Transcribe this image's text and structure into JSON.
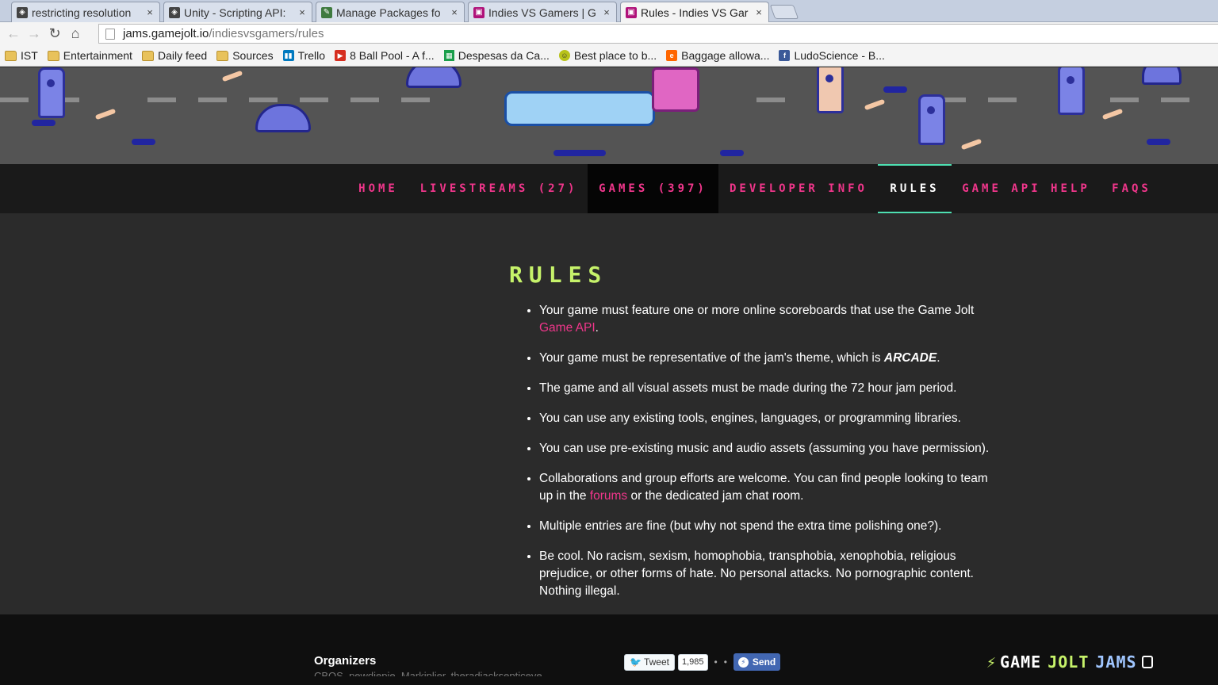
{
  "browser": {
    "tabs": [
      {
        "label": "restricting resolution",
        "favicon": "unity-icon",
        "active": false
      },
      {
        "label": "Unity - Scripting API:",
        "favicon": "unity-icon",
        "active": false
      },
      {
        "label": "Manage Packages fo",
        "favicon": "nuget-icon",
        "active": false
      },
      {
        "label": "Indies VS Gamers | G",
        "favicon": "gamejolt-icon",
        "active": false
      },
      {
        "label": "Rules - Indies VS Gar",
        "favicon": "gamejolt-icon",
        "active": true
      }
    ],
    "tab_close": "×",
    "nav": {
      "back": "←",
      "forward": "→",
      "reload": "↻",
      "home": "⌂"
    },
    "url": {
      "domain": "jams.gamejolt.io",
      "path": "/indiesvsgamers/rules"
    },
    "bookmarks": [
      {
        "label": "IST",
        "icon": "folder-icon"
      },
      {
        "label": "Entertainment",
        "icon": "folder-icon"
      },
      {
        "label": "Daily feed",
        "icon": "folder-icon"
      },
      {
        "label": "Sources",
        "icon": "folder-icon"
      },
      {
        "label": "Trello",
        "icon": "trello-icon"
      },
      {
        "label": "8 Ball Pool - A f...",
        "icon": "youtube-icon"
      },
      {
        "label": "Despesas da Ca...",
        "icon": "sheets-icon"
      },
      {
        "label": "Best place to b...",
        "icon": "smiley-icon"
      },
      {
        "label": "Baggage allowa...",
        "icon": "easyjet-icon"
      },
      {
        "label": "LudoScience - B...",
        "icon": "facebook-icon"
      }
    ]
  },
  "site": {
    "nav": [
      {
        "label": "HOME",
        "active": false
      },
      {
        "label": "LIVESTREAMS (27)",
        "active": false
      },
      {
        "label": "GAMES (397)",
        "active": false
      },
      {
        "label": "DEVELOPER INFO",
        "active": false
      },
      {
        "label": "RULES",
        "active": true
      },
      {
        "label": "GAME API HELP",
        "active": false
      },
      {
        "label": "FAQS",
        "active": false
      }
    ],
    "title": "RULES",
    "rules": {
      "r1_text": "Your game must feature one or more online scoreboards that use the Game Jolt ",
      "r1_link": "Game API",
      "r1_end": ".",
      "r2_text": "Your game must be representative of the jam's theme, which is ",
      "r2_theme": "ARCADE",
      "r2_end": ".",
      "r3": "The game and all visual assets must be made during the 72 hour jam period.",
      "r4": "You can use any existing tools, engines, languages, or programming libraries.",
      "r5": "You can use pre-existing music and audio assets (assuming you have permission).",
      "r6_text": "Collaborations and group efforts are welcome. You can find people looking to team up in the ",
      "r6_link": "forums",
      "r6_end": " or the dedicated jam chat room.",
      "r7": "Multiple entries are fine (but why not spend the extra time polishing one?).",
      "r8": "Be cool. No racism, sexism, homophobia, transphobia, xenophobia, religious prejudice, or other forms of hate. No personal attacks. No pornographic content. Nothing illegal."
    },
    "footer": {
      "organizers_label": "Organizers",
      "organizers_names": "CBOS, pewdiepie, Markiplier, theradjacksepticeye",
      "tweet_label": "Tweet",
      "tweet_count": "1,985",
      "separator": "•",
      "send_label": "Send",
      "logo_word1": "GAME",
      "logo_word2": "JOLT",
      "logo_word3": "JAMS"
    }
  },
  "colors": {
    "accent_pink": "#f0368b",
    "title_green": "#c6f26a",
    "active_underline": "#4ee0b2"
  }
}
